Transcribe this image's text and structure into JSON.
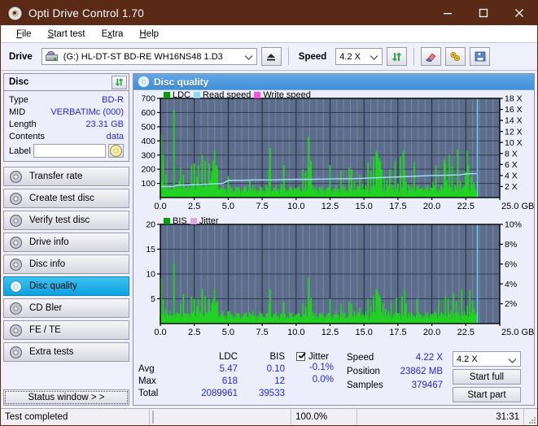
{
  "window": {
    "title": "Opti Drive Control 1.70",
    "app_icon": "disc-icon",
    "minimize": "–",
    "maximize": "□",
    "close": "✕",
    "titlebar_color": "#5b2a17"
  },
  "menu": [
    {
      "label": "File",
      "accel": "F"
    },
    {
      "label": "Start test",
      "accel": "S"
    },
    {
      "label": "Extra",
      "accel": "x"
    },
    {
      "label": "Help",
      "accel": "H"
    }
  ],
  "toolbar": {
    "drive_label": "Drive",
    "drive_value": "(G:)  HL-DT-ST BD-RE  WH16NS48 1.D3",
    "eject_icon": "eject-icon",
    "speed_label": "Speed",
    "speed_value": "4.2 X",
    "refresh_icon": "refresh-icon",
    "erase_icon": "eraser-icon",
    "tools_icon": "tools-icon",
    "save_icon": "save-icon",
    "chevron": "⌄"
  },
  "sidebar": {
    "disc_panel": {
      "title": "Disc",
      "refresh_icon": "refresh-icon",
      "rows": [
        {
          "key": "Type",
          "value": "BD-R"
        },
        {
          "key": "MID",
          "value": "VERBATIMc (000)"
        },
        {
          "key": "Length",
          "value": "23.31 GB"
        },
        {
          "key": "Contents",
          "value": "data"
        }
      ],
      "label_key": "Label",
      "label_value": "",
      "label_placeholder": "",
      "disc_icon": "disc-icon"
    },
    "nav": [
      {
        "label": "Transfer rate",
        "icon": "disc-icon",
        "active": false
      },
      {
        "label": "Create test disc",
        "icon": "disc-icon",
        "active": false
      },
      {
        "label": "Verify test disc",
        "icon": "disc-icon",
        "active": false
      },
      {
        "label": "Drive info",
        "icon": "disc-icon",
        "active": false
      },
      {
        "label": "Disc info",
        "icon": "disc-icon",
        "active": false
      },
      {
        "label": "Disc quality",
        "icon": "disc-icon",
        "active": true
      },
      {
        "label": "CD Bler",
        "icon": "disc-icon",
        "active": false
      },
      {
        "label": "FE / TE",
        "icon": "disc-icon",
        "active": false
      },
      {
        "label": "Extra tests",
        "icon": "disc-icon",
        "active": false
      }
    ],
    "status_window_button": "Status window > >"
  },
  "content": {
    "header_title": "Disc quality",
    "header_icon": "disc-icon"
  },
  "stats": {
    "col_headers": [
      "",
      "LDC",
      "BIS"
    ],
    "rows": [
      {
        "label": "Avg",
        "ldc": "5.47",
        "bis": "0.10"
      },
      {
        "label": "Max",
        "ldc": "618",
        "bis": "12"
      },
      {
        "label": "Total",
        "ldc": "2089961",
        "bis": "39533"
      }
    ],
    "jitter": {
      "checkbox_checked": true,
      "label": "Jitter",
      "values": [
        "-0.1%",
        "0.0%"
      ]
    },
    "readout": [
      {
        "key": "Speed",
        "value": "4.22 X"
      },
      {
        "key": "Position",
        "value": "23862 MB"
      },
      {
        "key": "Samples",
        "value": "379467"
      }
    ],
    "speed_select": "4.2 X",
    "speed_chevron": "⌄",
    "start_full": "Start full",
    "start_part": "Start part"
  },
  "statusbar": {
    "message": "Test completed",
    "progress_percent": 100.0,
    "percent_text": "100.0%",
    "elapsed": "31:31",
    "progress_color": "#0fa80f"
  },
  "chart_data": [
    {
      "type": "bar",
      "id": "ldc-chart",
      "title": "",
      "xlabel": "GB",
      "ylabel": "",
      "xlim": [
        0,
        25.0
      ],
      "ylim": [
        0,
        700
      ],
      "y2lim": [
        0,
        18
      ],
      "y2label": "X",
      "xticks": [
        0.0,
        2.5,
        5.0,
        7.5,
        10.0,
        12.5,
        15.0,
        17.5,
        20.0,
        22.5,
        25.0
      ],
      "xtick_labels": [
        "0.0",
        "2.5",
        "5.0",
        "7.5",
        "10.0",
        "12.5",
        "15.0",
        "17.5",
        "20.0",
        "22.5",
        "25.0 GB"
      ],
      "yticks": [
        100,
        200,
        300,
        400,
        500,
        600,
        700
      ],
      "ytick_labels": [
        "100",
        "200",
        "300",
        "400",
        "500",
        "600",
        "700"
      ],
      "y2ticks": [
        2,
        4,
        6,
        8,
        10,
        12,
        14,
        16,
        18
      ],
      "y2tick_labels": [
        "2 X",
        "4 X",
        "6 X",
        "8 X",
        "10 X",
        "12 X",
        "14 X",
        "16 X",
        "18 X"
      ],
      "grid": true,
      "plot_bg": "#5d6d8c",
      "legend_position": "top-left",
      "legend": [
        {
          "name": "LDC",
          "color": "#00a000"
        },
        {
          "name": "Read speed",
          "color": "#8fd8f4"
        },
        {
          "name": "Write speed",
          "color": "#ff4fd8"
        }
      ],
      "series": [
        {
          "name": "LDC",
          "color": "#21d321",
          "x": [
            0.05,
            0.1,
            0.15,
            0.2,
            0.25,
            0.3,
            0.35,
            0.4,
            0.45,
            0.5,
            0.6,
            0.7,
            0.8,
            0.9,
            1.0,
            1.05,
            1.1,
            1.2,
            1.3,
            1.4,
            1.5,
            1.6,
            1.7,
            1.75,
            1.8,
            1.9,
            2.0,
            2.1,
            2.2,
            2.3,
            2.4,
            2.5,
            2.6,
            2.7,
            2.8,
            2.9,
            3.0,
            3.1,
            3.2,
            3.3,
            3.4,
            3.5,
            3.6,
            3.7,
            3.8,
            3.9,
            4.0,
            4.05,
            4.1,
            4.15,
            4.2,
            4.3,
            4.4,
            4.5,
            4.6,
            4.7,
            4.8,
            4.9,
            5.0,
            5.2,
            5.4,
            5.6,
            5.8,
            6.0,
            6.2,
            6.4,
            6.6,
            6.8,
            7.0,
            7.2,
            7.4,
            7.6,
            7.8,
            8.0,
            8.1,
            8.3,
            8.5,
            8.7,
            8.9,
            9.1,
            9.3,
            9.5,
            9.7,
            9.9,
            10.1,
            10.3,
            10.5,
            10.7,
            10.9,
            11.0,
            11.1,
            11.3,
            11.5,
            11.7,
            11.9,
            12.1,
            12.3,
            12.5,
            12.7,
            12.9,
            13.1,
            13.3,
            13.5,
            13.7,
            13.9,
            14.1,
            14.3,
            14.5,
            14.7,
            14.9,
            15.1,
            15.3,
            15.5,
            15.7,
            15.9,
            16.0,
            16.1,
            16.2,
            16.3,
            16.5,
            16.7,
            16.9,
            17.1,
            17.3,
            17.5,
            17.7,
            17.9,
            18.0,
            18.1,
            18.3,
            18.5,
            18.7,
            18.9,
            19.1,
            19.3,
            19.5,
            19.7,
            19.9,
            20.0,
            20.1,
            20.3,
            20.5,
            20.7,
            20.9,
            21.0,
            21.1,
            21.3,
            21.5,
            21.7,
            21.9,
            22.1,
            22.3,
            22.5,
            22.6,
            22.7,
            22.9,
            23.0,
            23.1,
            23.2,
            23.3
          ],
          "values": [
            440,
            120,
            60,
            300,
            90,
            50,
            70,
            160,
            40,
            55,
            45,
            80,
            50,
            60,
            615,
            90,
            70,
            50,
            60,
            120,
            210,
            60,
            160,
            85,
            55,
            70,
            50,
            90,
            60,
            230,
            100,
            240,
            60,
            150,
            230,
            60,
            80,
            300,
            70,
            260,
            90,
            50,
            240,
            120,
            180,
            260,
            330,
            200,
            220,
            230,
            200,
            60,
            55,
            50,
            40,
            60,
            35,
            30,
            150,
            40,
            35,
            60,
            45,
            30,
            80,
            40,
            120,
            35,
            55,
            30,
            45,
            25,
            90,
            200,
            350,
            45,
            30,
            60,
            100,
            230,
            40,
            60,
            30,
            70,
            45,
            50,
            200,
            180,
            430,
            220,
            260,
            40,
            60,
            30,
            50,
            40,
            60,
            230,
            30,
            50,
            40,
            190,
            60,
            30,
            210,
            200,
            120,
            60,
            160,
            100,
            60,
            250,
            180,
            290,
            330,
            310,
            280,
            260,
            200,
            150,
            120,
            200,
            90,
            260,
            100,
            290,
            330,
            190,
            110,
            90,
            60,
            250,
            80,
            55,
            70,
            40,
            90,
            70,
            60,
            110,
            230,
            50,
            90,
            270,
            240,
            120,
            300,
            220,
            90,
            340,
            120,
            70,
            180,
            330,
            230,
            150,
            90,
            110,
            60,
            50
          ]
        },
        {
          "name": "Read speed",
          "color": "#9fe2f8",
          "type": "line",
          "axis": "y2",
          "x": [
            0.0,
            1.0,
            1.2,
            2.0,
            3.0,
            4.0,
            4.6,
            5.0,
            6.0,
            7.0,
            8.0,
            9.0,
            10.0,
            11.0,
            12.0,
            13.0,
            14.0,
            15.0,
            16.0,
            17.0,
            18.0,
            19.0,
            20.0,
            21.0,
            22.0,
            22.6,
            23.3
          ],
          "values": [
            2.0,
            2.0,
            2.25,
            2.3,
            2.4,
            2.5,
            2.55,
            3.1,
            3.15,
            3.2,
            3.2,
            3.25,
            3.3,
            3.3,
            3.35,
            3.4,
            3.4,
            3.5,
            3.6,
            3.7,
            3.8,
            3.9,
            4.0,
            4.05,
            4.1,
            4.3,
            4.35
          ]
        },
        {
          "name": "Cursor",
          "color": "#5fd4f5",
          "type": "vline",
          "x": 23.35
        }
      ]
    },
    {
      "type": "bar",
      "id": "bis-jitter-chart",
      "title": "",
      "xlabel": "GB",
      "ylabel": "",
      "xlim": [
        0,
        25.0
      ],
      "ylim": [
        0,
        20
      ],
      "y2lim": [
        0,
        10
      ],
      "y2label": "%",
      "xticks": [
        0.0,
        2.5,
        5.0,
        7.5,
        10.0,
        12.5,
        15.0,
        17.5,
        20.0,
        22.5,
        25.0
      ],
      "xtick_labels": [
        "0.0",
        "2.5",
        "5.0",
        "7.5",
        "10.0",
        "12.5",
        "15.0",
        "17.5",
        "20.0",
        "22.5",
        "25.0 GB"
      ],
      "yticks": [
        5,
        10,
        15,
        20
      ],
      "ytick_labels": [
        "5",
        "10",
        "15",
        "20"
      ],
      "y2ticks": [
        2,
        4,
        6,
        8,
        10
      ],
      "y2tick_labels": [
        "2%",
        "4%",
        "6%",
        "8%",
        "10%"
      ],
      "grid": true,
      "plot_bg": "#5d6d8c",
      "legend_position": "top-left",
      "legend": [
        {
          "name": "BIS",
          "color": "#00a000"
        },
        {
          "name": "Jitter",
          "color": "#d9a9e0"
        }
      ],
      "series": [
        {
          "name": "BIS",
          "color": "#21d321",
          "x": [
            0.05,
            0.1,
            0.15,
            0.2,
            0.25,
            0.3,
            0.35,
            0.4,
            0.5,
            0.6,
            0.7,
            0.8,
            0.9,
            1.0,
            1.05,
            1.1,
            1.2,
            1.3,
            1.4,
            1.5,
            1.6,
            1.7,
            1.8,
            1.9,
            2.0,
            2.1,
            2.2,
            2.3,
            2.4,
            2.5,
            2.6,
            2.7,
            2.8,
            2.9,
            3.0,
            3.1,
            3.2,
            3.3,
            3.4,
            3.5,
            3.6,
            3.7,
            3.8,
            3.9,
            4.0,
            4.1,
            4.2,
            4.3,
            4.4,
            4.5,
            4.6,
            4.8,
            5.0,
            5.2,
            5.4,
            5.6,
            5.8,
            6.0,
            6.2,
            6.4,
            6.6,
            6.8,
            7.0,
            7.2,
            7.4,
            7.6,
            7.8,
            8.0,
            8.1,
            8.3,
            8.5,
            8.7,
            8.9,
            9.1,
            9.3,
            9.5,
            9.7,
            9.9,
            10.1,
            10.3,
            10.5,
            10.7,
            10.9,
            11.0,
            11.1,
            11.3,
            11.5,
            11.7,
            11.9,
            12.1,
            12.3,
            12.5,
            12.7,
            12.9,
            13.1,
            13.3,
            13.5,
            13.7,
            13.9,
            14.1,
            14.3,
            14.5,
            14.7,
            14.9,
            15.1,
            15.3,
            15.5,
            15.7,
            15.9,
            16.0,
            16.1,
            16.2,
            16.4,
            16.6,
            16.8,
            17.0,
            17.2,
            17.4,
            17.6,
            17.8,
            18.0,
            18.1,
            18.3,
            18.5,
            18.7,
            18.9,
            19.1,
            19.3,
            19.5,
            19.7,
            19.9,
            20.0,
            20.1,
            20.3,
            20.5,
            20.7,
            20.9,
            21.0,
            21.2,
            21.4,
            21.6,
            21.8,
            22.0,
            22.2,
            22.4,
            22.5,
            22.6,
            22.8,
            23.0,
            23.1,
            23.2,
            23.3
          ],
          "values": [
            9.0,
            2.0,
            1.2,
            4.8,
            2.0,
            1.0,
            1.5,
            3.0,
            1.0,
            1.2,
            1.0,
            1.5,
            1.2,
            12.2,
            2.0,
            1.5,
            1.0,
            1.2,
            2.0,
            4.0,
            1.2,
            6.0,
            2.0,
            1.5,
            1.2,
            2.0,
            1.2,
            5.5,
            2.0,
            5.0,
            1.5,
            3.5,
            5.0,
            1.5,
            2.0,
            7.0,
            1.5,
            5.5,
            2.0,
            1.2,
            5.0,
            2.5,
            4.0,
            5.0,
            6.9,
            4.0,
            4.5,
            1.5,
            1.2,
            1.0,
            1.0,
            1.0,
            2.5,
            1.0,
            0.8,
            1.2,
            1.0,
            0.8,
            1.5,
            1.0,
            2.2,
            0.8,
            1.2,
            0.8,
            1.0,
            0.6,
            1.8,
            4.0,
            7.0,
            1.0,
            0.8,
            1.2,
            2.0,
            4.4,
            0.8,
            1.2,
            0.8,
            1.5,
            1.0,
            1.0,
            4.0,
            3.5,
            9.2,
            4.5,
            5.2,
            0.8,
            1.2,
            0.8,
            1.0,
            0.8,
            1.2,
            5.0,
            0.8,
            1.0,
            0.8,
            4.0,
            1.2,
            0.8,
            4.4,
            4.0,
            2.5,
            1.2,
            3.2,
            2.0,
            1.2,
            5.0,
            3.5,
            5.5,
            6.9,
            6.5,
            5.8,
            5.2,
            4.0,
            3.0,
            2.5,
            4.2,
            1.8,
            5.2,
            2.0,
            5.5,
            6.8,
            4.0,
            2.2,
            1.8,
            1.2,
            5.0,
            1.6,
            1.1,
            1.4,
            0.8,
            1.8,
            1.4,
            1.2,
            2.2,
            4.8,
            1.0,
            1.8,
            5.6,
            5.0,
            2.5,
            6.2,
            4.5,
            1.8,
            7.0,
            2.5,
            1.4,
            3.6,
            6.8,
            4.6,
            3.0,
            1.8,
            2.2,
            1.2,
            1.0
          ]
        },
        {
          "name": "Cursor",
          "color": "#5fd4f5",
          "type": "vline",
          "x": 23.35
        }
      ]
    }
  ]
}
